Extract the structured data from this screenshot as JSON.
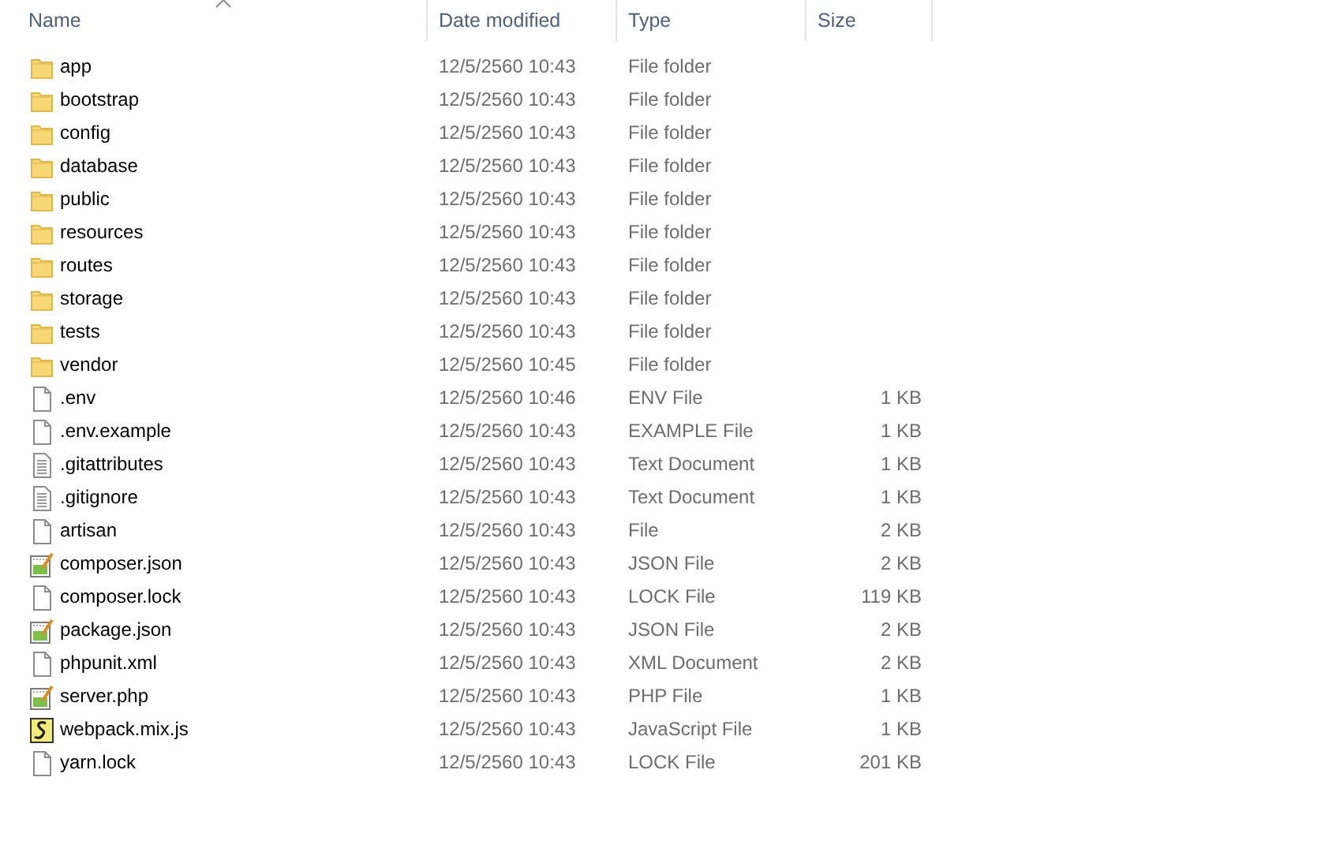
{
  "columns": [
    {
      "label": "Name",
      "sorted": true
    },
    {
      "label": "Date modified",
      "sorted": false
    },
    {
      "label": "Type",
      "sorted": false
    },
    {
      "label": "Size",
      "sorted": false
    }
  ],
  "files": [
    {
      "name": "app",
      "date": "12/5/2560 10:43",
      "type": "File folder",
      "kind": "folder"
    },
    {
      "name": "bootstrap",
      "date": "12/5/2560 10:43",
      "type": "File folder",
      "kind": "folder"
    },
    {
      "name": "config",
      "date": "12/5/2560 10:43",
      "type": "File folder",
      "kind": "folder"
    },
    {
      "name": "database",
      "date": "12/5/2560 10:43",
      "type": "File folder",
      "kind": "folder"
    },
    {
      "name": "public",
      "date": "12/5/2560 10:43",
      "type": "File folder",
      "kind": "folder"
    },
    {
      "name": "resources",
      "date": "12/5/2560 10:43",
      "type": "File folder",
      "kind": "folder"
    },
    {
      "name": "routes",
      "date": "12/5/2560 10:43",
      "type": "File folder",
      "kind": "folder"
    },
    {
      "name": "storage",
      "date": "12/5/2560 10:43",
      "type": "File folder",
      "kind": "folder"
    },
    {
      "name": "tests",
      "date": "12/5/2560 10:43",
      "type": "File folder",
      "kind": "folder"
    },
    {
      "name": "vendor",
      "date": "12/5/2560 10:45",
      "type": "File folder",
      "kind": "folder"
    },
    {
      "name": ".env",
      "date": "12/5/2560 10:46",
      "type": "ENV File",
      "size": "1 KB",
      "kind": "blank"
    },
    {
      "name": ".env.example",
      "date": "12/5/2560 10:43",
      "type": "EXAMPLE File",
      "size": "1 KB",
      "kind": "blank"
    },
    {
      "name": ".gitattributes",
      "date": "12/5/2560 10:43",
      "type": "Text Document",
      "size": "1 KB",
      "kind": "text"
    },
    {
      "name": ".gitignore",
      "date": "12/5/2560 10:43",
      "type": "Text Document",
      "size": "1 KB",
      "kind": "text"
    },
    {
      "name": "artisan",
      "date": "12/5/2560 10:43",
      "type": "File",
      "size": "2 KB",
      "kind": "blank"
    },
    {
      "name": "composer.json",
      "date": "12/5/2560 10:43",
      "type": "JSON File",
      "size": "2 KB",
      "kind": "editor"
    },
    {
      "name": "composer.lock",
      "date": "12/5/2560 10:43",
      "type": "LOCK File",
      "size": "119 KB",
      "kind": "blank"
    },
    {
      "name": "package.json",
      "date": "12/5/2560 10:43",
      "type": "JSON File",
      "size": "2 KB",
      "kind": "editor"
    },
    {
      "name": "phpunit.xml",
      "date": "12/5/2560 10:43",
      "type": "XML Document",
      "size": "2 KB",
      "kind": "blank"
    },
    {
      "name": "server.php",
      "date": "12/5/2560 10:43",
      "type": "PHP File",
      "size": "1 KB",
      "kind": "editor"
    },
    {
      "name": "webpack.mix.js",
      "date": "12/5/2560 10:43",
      "type": "JavaScript File",
      "size": "1 KB",
      "kind": "script"
    },
    {
      "name": "yarn.lock",
      "date": "12/5/2560 10:43",
      "type": "LOCK File",
      "size": "201 KB",
      "kind": "blank"
    }
  ]
}
